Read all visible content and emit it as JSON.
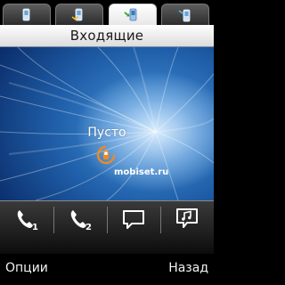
{
  "tabs": [
    {
      "icon": "phone-incoming-icon",
      "active": false
    },
    {
      "icon": "phone-missed-icon",
      "active": false
    },
    {
      "icon": "phone-received-icon",
      "active": true
    },
    {
      "icon": "phone-outgoing-icon",
      "active": false
    }
  ],
  "header": {
    "title": "Входящие"
  },
  "content": {
    "empty_text": "Пусто"
  },
  "watermark": {
    "text": "mobiset.ru"
  },
  "actions": [
    {
      "icon": "call-sim1-icon",
      "sim": "1"
    },
    {
      "icon": "call-sim2-icon",
      "sim": "2"
    },
    {
      "icon": "message-icon"
    },
    {
      "icon": "music-note-icon"
    }
  ],
  "softkeys": {
    "left": "Опции",
    "right": "Назад"
  },
  "colors": {
    "title_bg": "#f4f4f4",
    "wallpaper": "#1f5ea8",
    "accent_orange": "#f08a1c"
  }
}
